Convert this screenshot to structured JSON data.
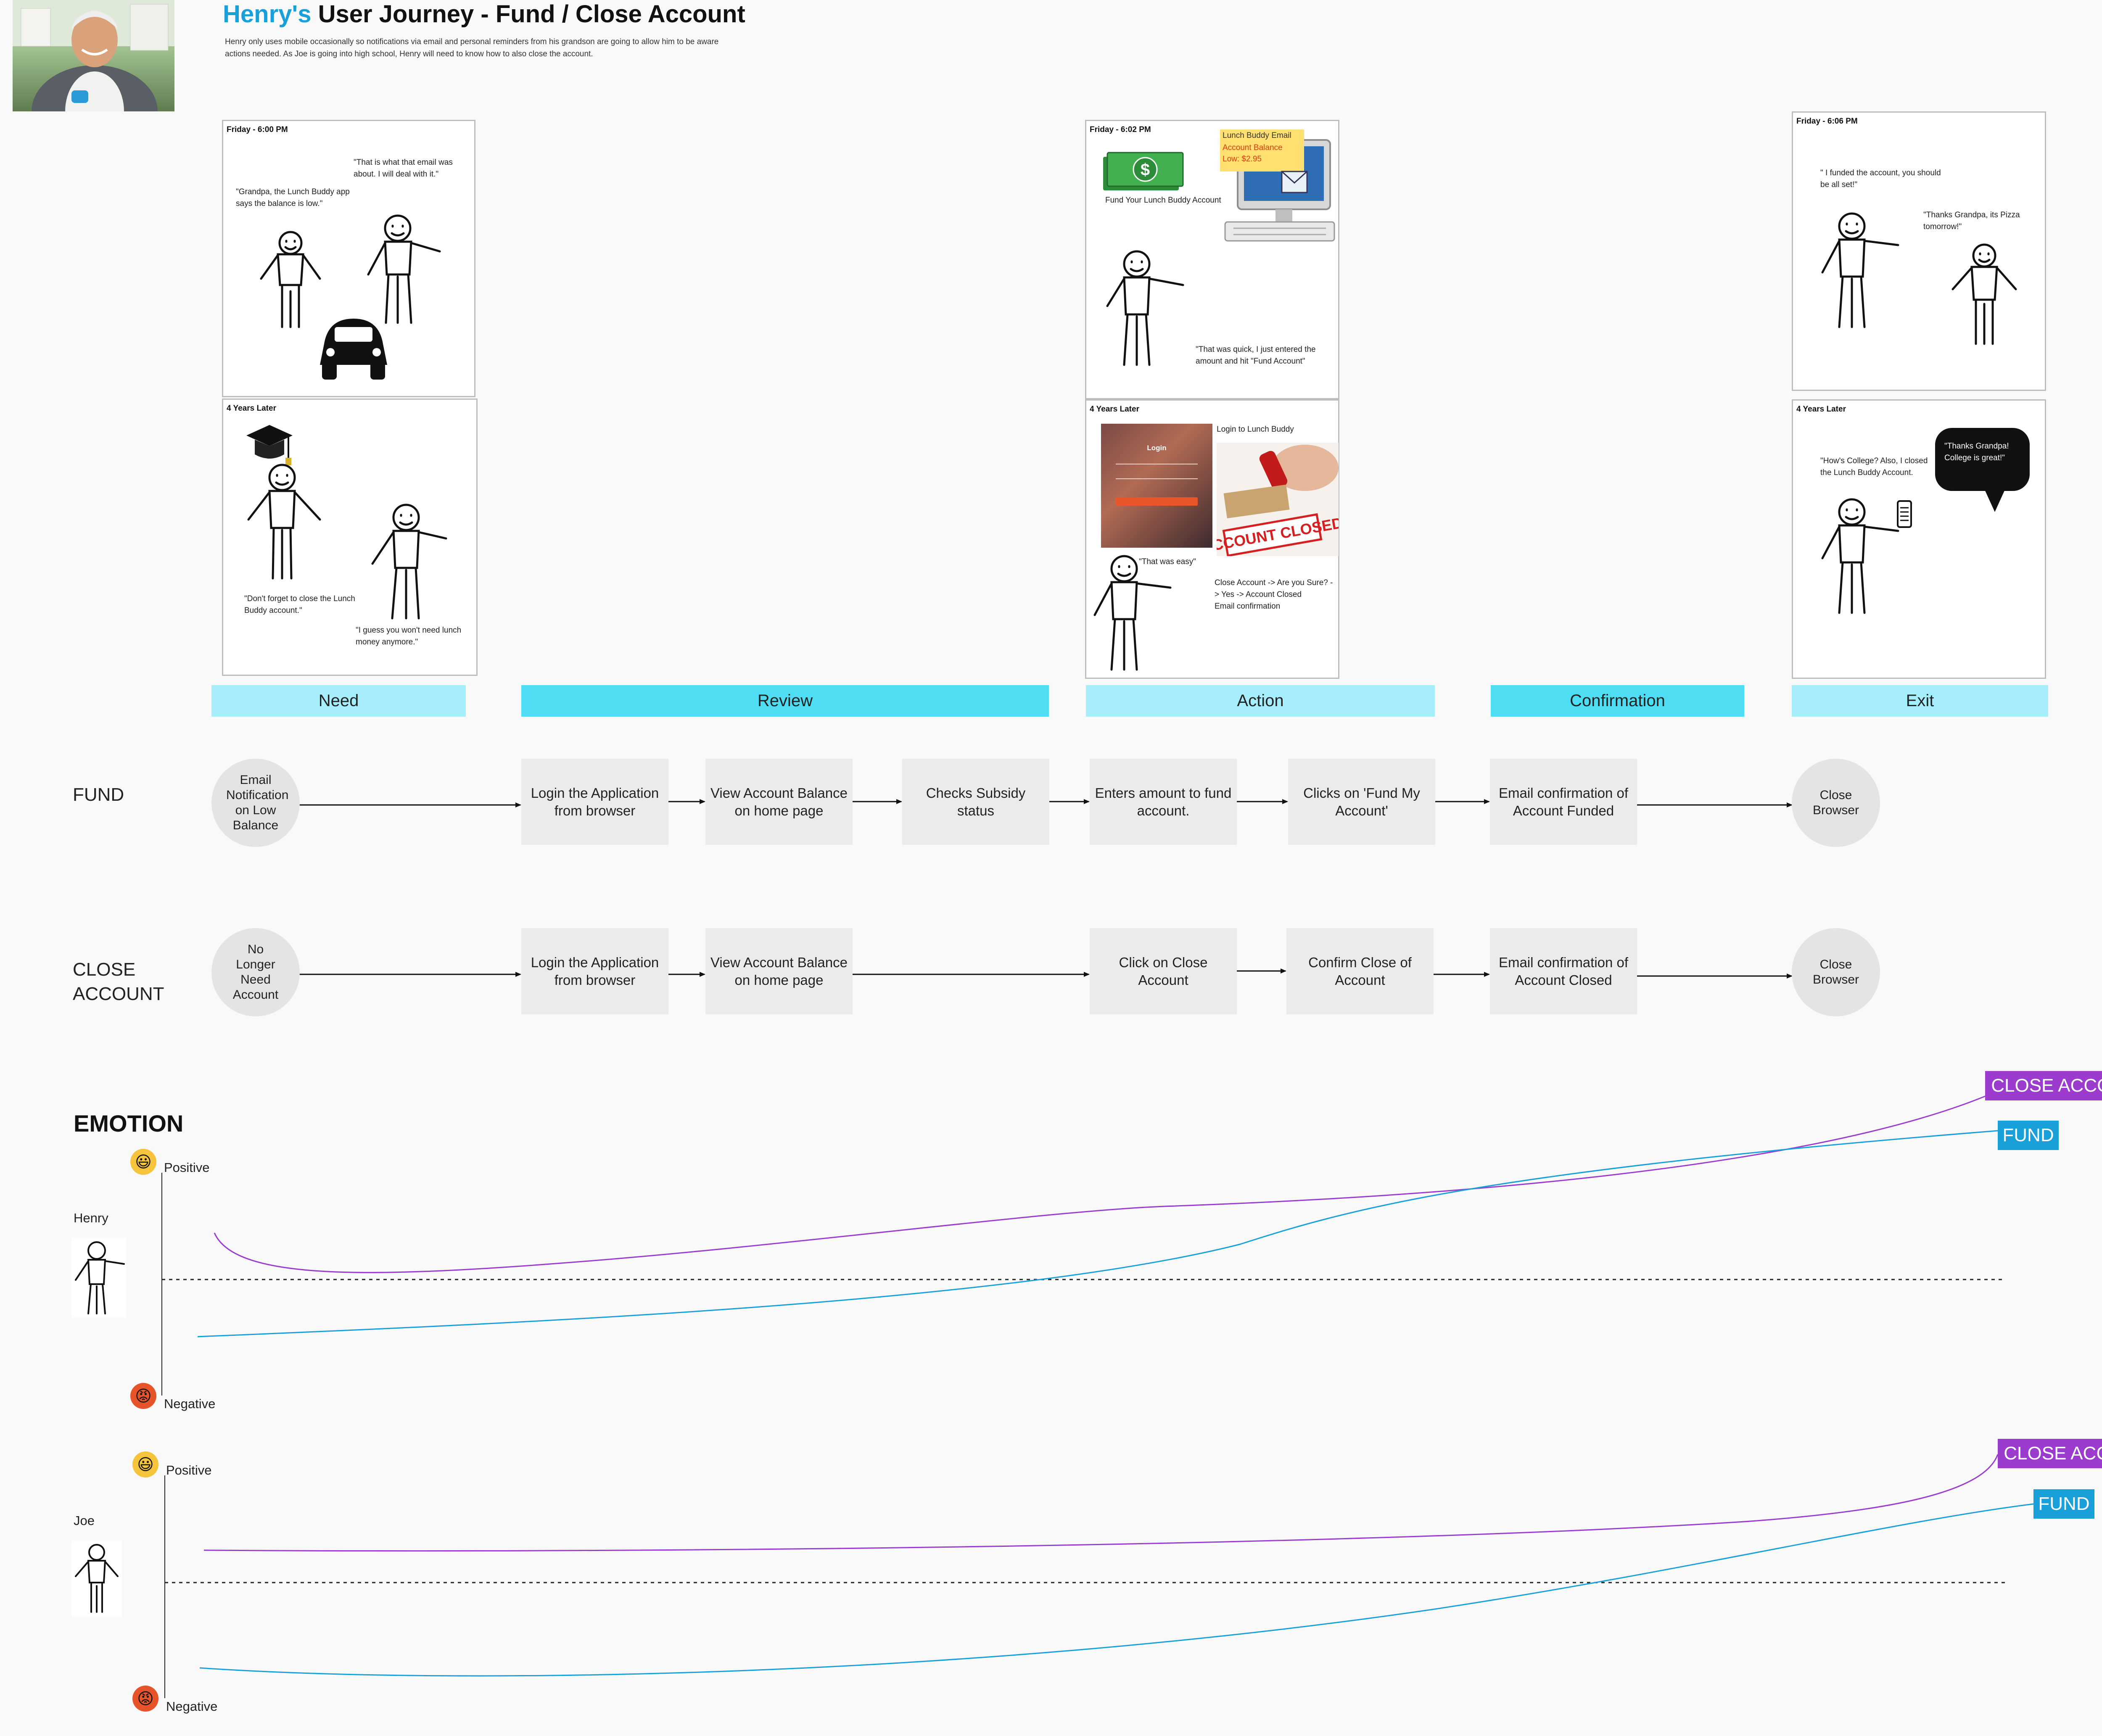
{
  "header": {
    "title_name": "Henry's",
    "title_rest": " User Journey - Fund / Close Account",
    "intro": "Henry only uses mobile occasionally so notifications via email and personal reminders from his grandson are going to allow him to be aware actions needed.  As Joe is going into high school, Henry will need to know how to also close the account."
  },
  "panels": {
    "need_top": {
      "label": "Friday - 6:00 PM",
      "henry_quote": "\"That is what that email was about.  I will deal with it.\"",
      "joe_quote": "\"Grandpa, the Lunch Buddy app says the balance is low.\""
    },
    "need_bottom": {
      "label": "4 Years Later",
      "joe_quote": "\"Don't forget to close the Lunch Buddy account.\"",
      "henry_quote": "\"I guess you won't need lunch money anymore.\""
    },
    "action_top": {
      "label": "Friday - 6:02 PM",
      "email_title": "Lunch Buddy Email",
      "email_body": "Account Balance Low: $2.95",
      "money_caption": "Fund Your Lunch Buddy Account",
      "quote": "\"That was quick, I just entered the amount and hit \"Fund Account\""
    },
    "action_bottom": {
      "label": "4 Years Later",
      "login_caption": "Login to Lunch Buddy",
      "login_screen": "Login",
      "stamp_text": "ACCOUNT CLOSED",
      "easy_quote": "\"That was easy\"",
      "steps": "Close Account -> Are you Sure? -> Yes -> Account Closed\nEmail confirmation"
    },
    "exit_top": {
      "label": "Friday - 6:06 PM",
      "henry_quote": "\" I funded the account, you should be all set!\"",
      "joe_quote": "\"Thanks Grandpa, its Pizza tomorrow!\""
    },
    "exit_bottom": {
      "label": "4 Years Later",
      "henry_quote": "\"How's College? Also, I closed the Lunch Buddy Account.",
      "joe_bubble": "\"Thanks Grandpa! College is great!\""
    }
  },
  "stages": [
    "Need",
    "Review",
    "Action",
    "Confirmation",
    "Exit"
  ],
  "flows": {
    "fund": {
      "label": "FUND",
      "start": "Email Notification on Low Balance",
      "steps": [
        "Login the Application from browser",
        "View Account Balance on home page",
        "Checks Subsidy status",
        "Enters amount to fund account.",
        "Clicks on 'Fund My Account'",
        "Email confirmation of Account Funded"
      ],
      "end": "Close Browser"
    },
    "close": {
      "label": "CLOSE ACCOUNT",
      "start": "No Longer Need Account",
      "steps": [
        "Login the Application from browser",
        "View Account Balance on home page",
        "Click on Close Account",
        "Confirm Close of Account",
        "Email confirmation of Account Closed"
      ],
      "end": "Close Browser"
    }
  },
  "emotion": {
    "title": "EMOTION",
    "positive": "Positive",
    "negative": "Negative",
    "henry": "Henry",
    "joe": "Joe",
    "close_tag": "CLOSE ACCOUNT",
    "fund_tag": "FUND",
    "colors": {
      "close": "#9b3ccf",
      "fund": "#1aa0d8"
    }
  }
}
